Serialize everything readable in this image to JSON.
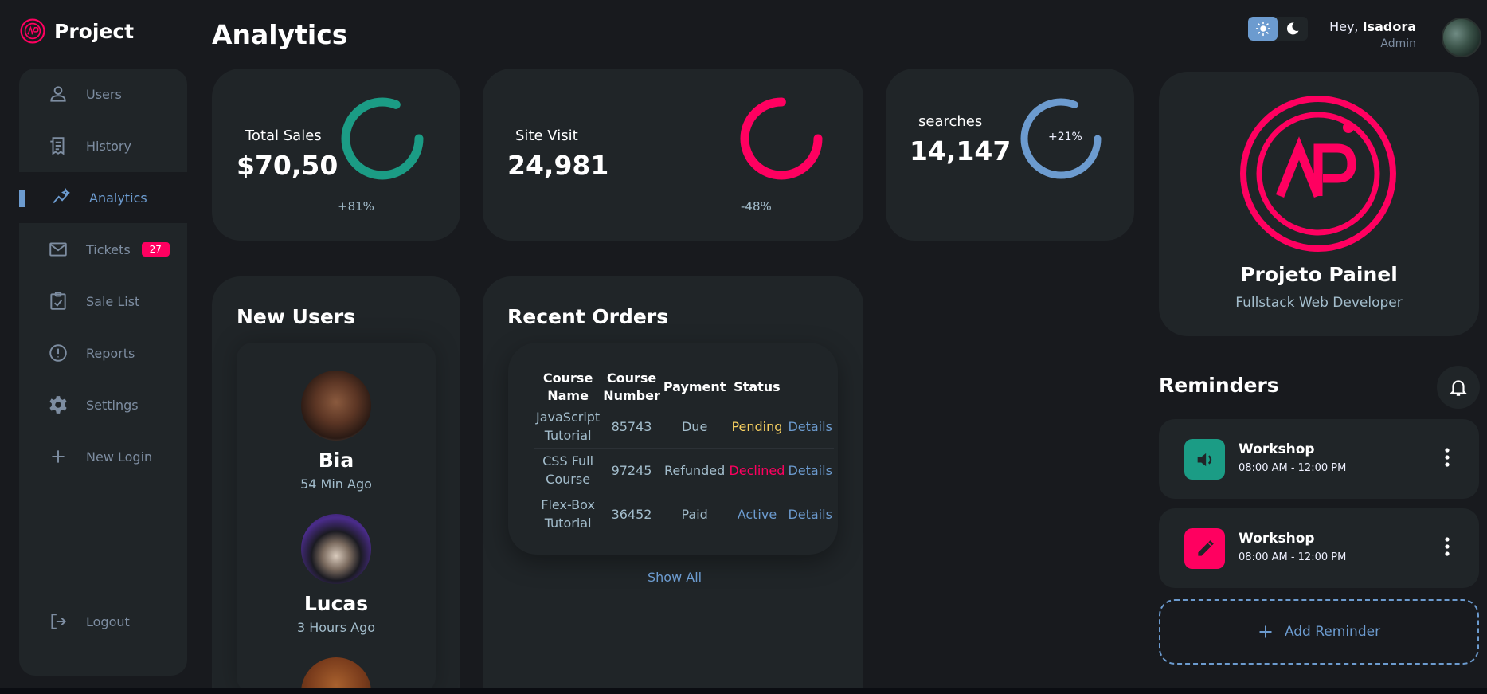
{
  "brand": {
    "name": "Project"
  },
  "sidebar": {
    "items": [
      {
        "label": "Users",
        "icon": "user-icon"
      },
      {
        "label": "History",
        "icon": "receipt-icon"
      },
      {
        "label": "Analytics",
        "icon": "insights-icon",
        "active": true
      },
      {
        "label": "Tickets",
        "icon": "mail-icon",
        "badge": "27"
      },
      {
        "label": "Sale List",
        "icon": "clipboard-check-icon"
      },
      {
        "label": "Reports",
        "icon": "alert-circle-icon"
      },
      {
        "label": "Settings",
        "icon": "gear-icon"
      },
      {
        "label": "New Login",
        "icon": "plus-icon"
      }
    ],
    "logout": "Logout"
  },
  "header": {
    "title": "Analytics",
    "greeting": "Hey,",
    "user_name": "Isadora",
    "role": "Admin"
  },
  "stats": [
    {
      "label": "Total Sales",
      "value": "$70,50",
      "percent": "+81%",
      "progress": 0.81,
      "color": "#1b9c85"
    },
    {
      "label": "Site Visit",
      "value": "24,981",
      "percent": "-48%",
      "progress": 0.75,
      "color": "#ff0060"
    },
    {
      "label": "searches",
      "value": "14,147",
      "percent": "+21%",
      "progress": 0.81,
      "color": "#6c9bcf"
    }
  ],
  "new_users": {
    "title": "New Users",
    "users": [
      {
        "name": "Bia",
        "time": "54 Min Ago"
      },
      {
        "name": "Lucas",
        "time": "3 Hours Ago"
      }
    ]
  },
  "orders": {
    "title": "Recent Orders",
    "columns": [
      "Course Name",
      "Course Number",
      "Payment",
      "Status"
    ],
    "rows": [
      {
        "name": "JavaScript Tutorial",
        "number": "85743",
        "payment": "Due",
        "status": "Pending",
        "details": "Details"
      },
      {
        "name": "CSS Full Course",
        "number": "97245",
        "payment": "Refunded",
        "status": "Declined",
        "details": "Details"
      },
      {
        "name": "Flex-Box Tutorial",
        "number": "36452",
        "payment": "Paid",
        "status": "Active",
        "details": "Details"
      }
    ],
    "show_all": "Show All"
  },
  "profile": {
    "name": "Projeto Painel",
    "role": "Fullstack Web Developer"
  },
  "reminders": {
    "title": "Reminders",
    "items": [
      {
        "title": "Workshop",
        "time": "08:00 AM - 12:00 PM",
        "icon": "volume-icon",
        "color": "#1b9c85"
      },
      {
        "title": "Workshop",
        "time": "08:00 AM - 12:00 PM",
        "icon": "edit-icon",
        "color": "#ff0060"
      }
    ],
    "add_label": "Add Reminder"
  }
}
